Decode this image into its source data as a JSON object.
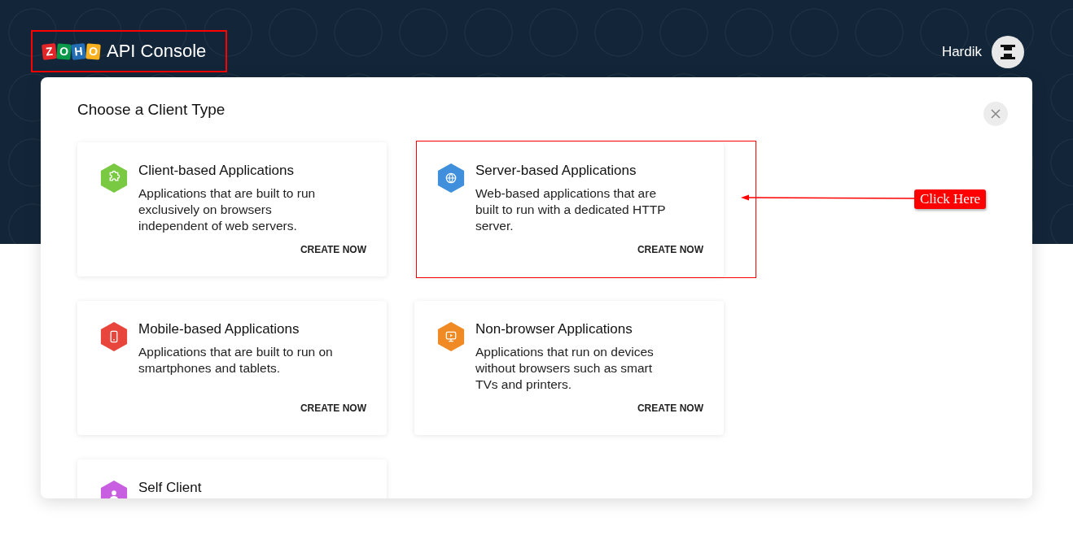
{
  "header": {
    "logo_letters": [
      {
        "letter": "Z",
        "color": "#e42527"
      },
      {
        "letter": "O",
        "color": "#089949"
      },
      {
        "letter": "H",
        "color": "#226db4"
      },
      {
        "letter": "O",
        "color": "#f9b21d"
      }
    ],
    "title": "API Console",
    "highlighted": true,
    "user": "Hardik"
  },
  "dialog": {
    "title": "Choose a Client Type",
    "cards": [
      {
        "kind": "puzzle",
        "color": "#7ac943",
        "title": "Client-based Applications",
        "description": "Applications that are built to run exclusively on browsers independent of web servers.",
        "action": "CREATE NOW",
        "highlighted": false
      },
      {
        "kind": "globe",
        "color": "#3f8fdc",
        "title": "Server-based Applications",
        "description": "Web-based applications that are built to run with a dedicated HTTP server.",
        "action": "CREATE NOW",
        "highlighted": true
      },
      {
        "kind": "phone",
        "color": "#e8453c",
        "title": "Mobile-based Applications",
        "description": "Applications that are built to run on smartphones and tablets.",
        "action": "CREATE NOW",
        "highlighted": false
      },
      {
        "kind": "monitor",
        "color": "#f08a24",
        "title": "Non-browser Applications",
        "description": "Applications that run on devices without browsers such as smart TVs and printers.",
        "action": "CREATE NOW",
        "highlighted": false
      },
      {
        "kind": "person",
        "color": "#c85ee0",
        "title": "Self Client",
        "highlighted": false
      }
    ]
  },
  "callout": {
    "text": "Click Here"
  }
}
